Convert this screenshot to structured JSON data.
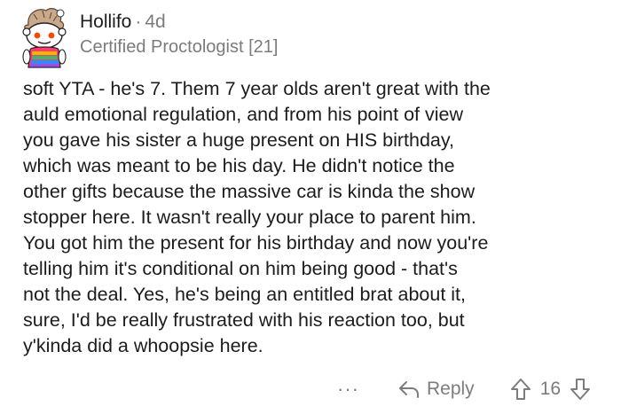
{
  "comment": {
    "username": "Hollifo",
    "separator": "·",
    "age": "4d",
    "flair": "Certified Proctologist [21]",
    "body_lines": [
      "soft YTA - he's 7. Them 7 year olds aren't great with the",
      "auld emotional regulation, and from his point of view",
      "you gave his sister a huge present on HIS birthday,",
      "which was meant to be his day. He didn't notice the",
      "other gifts because the massive car is kinda the show",
      "stopper here. It wasn't really your place to parent him.",
      "You got him the present for his birthday and now you're",
      "telling him it's conditional on him being good - that's",
      "not the deal. Yes, he's being an entitled brat about it,",
      "sure, I'd be really frustrated with his reaction too, but",
      "y'kinda did a whoopsie here."
    ]
  },
  "actions": {
    "more": "···",
    "reply_label": "Reply",
    "score": "16"
  },
  "icons": {
    "avatar": "snoo-avatar-icon",
    "reply": "reply-arrow-icon",
    "upvote": "upvote-arrow-icon",
    "downvote": "downvote-arrow-icon"
  },
  "colors": {
    "text": "#1c1c1c",
    "meta": "#7c7c7c",
    "background": "#ffffff"
  }
}
